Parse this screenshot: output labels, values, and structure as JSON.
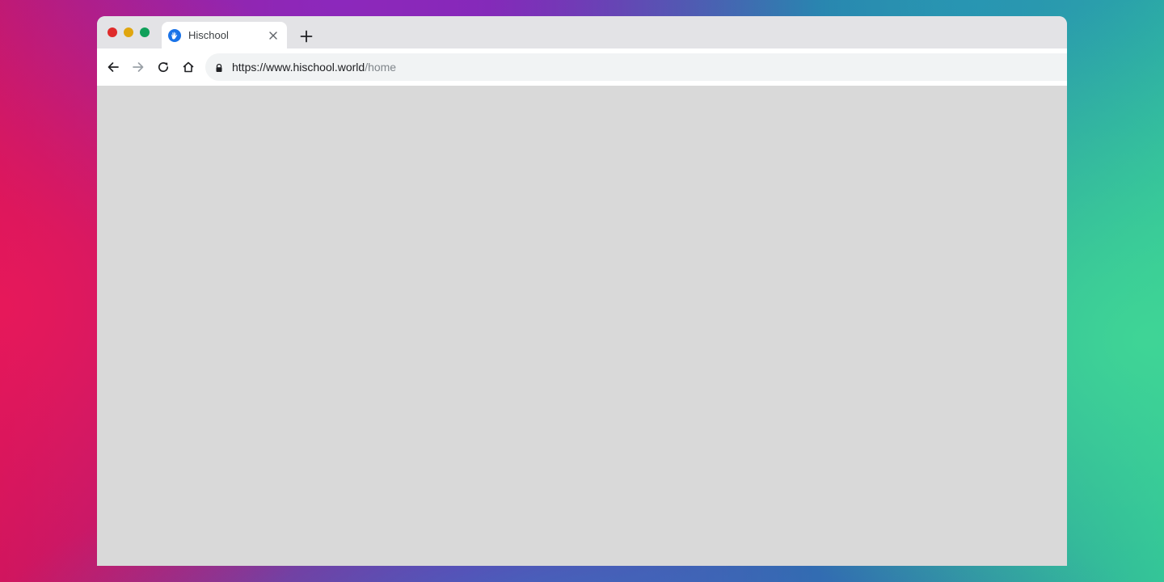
{
  "colors": {
    "traffic_close": "#df2b2b",
    "traffic_minimize": "#e0a60f",
    "traffic_maximize": "#10a05a",
    "favicon": "#1a73e8",
    "content_background": "#d9d9d9"
  },
  "window": {
    "traffic_lights": [
      "close",
      "minimize",
      "maximize"
    ]
  },
  "tabs": [
    {
      "title": "Hischool",
      "favicon": "waving-hand-icon",
      "close_icon": "close-icon",
      "active": true
    }
  ],
  "tabstrip": {
    "new_tab_icon": "plus-icon"
  },
  "toolbar": {
    "back_icon": "arrow-left-icon",
    "forward_icon": "arrow-right-icon",
    "forward_enabled": false,
    "reload_icon": "reload-icon",
    "home_icon": "home-icon"
  },
  "address_bar": {
    "secure_icon": "lock-icon",
    "url_host": "https://www.hischool.world",
    "url_path": "/home"
  }
}
